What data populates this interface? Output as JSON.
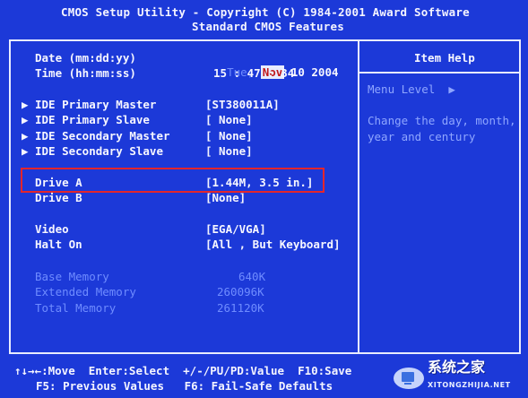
{
  "header": {
    "line1": "CMOS Setup Utility - Copyright (C) 1984-2001 Award Software",
    "line2": "Standard CMOS Features"
  },
  "settings": {
    "date_label": "Date (mm:dd:yy)",
    "date_day": "Tue,",
    "date_month": "Nov",
    "date_rest": "10 2004",
    "time_label": "Time (hh:mm:ss)",
    "time_value": "15 : 47 : 34",
    "ide_items": [
      {
        "label": "IDE Primary Master",
        "value": "[ST380011A]"
      },
      {
        "label": "IDE Primary Slave",
        "value": "[ None]"
      },
      {
        "label": "IDE Secondary Master",
        "value": "[ None]"
      },
      {
        "label": "IDE Secondary Slave",
        "value": "[ None]"
      }
    ],
    "drive_a_label": "Drive A",
    "drive_a_value": "[1.44M, 3.5 in.]",
    "drive_b_label": "Drive B",
    "drive_b_value": "[None]",
    "video_label": "Video",
    "video_value": "[EGA/VGA]",
    "halt_label": "Halt On",
    "halt_value": "[All , But Keyboard]",
    "memory": [
      {
        "label": "Base Memory",
        "value": "640K"
      },
      {
        "label": "Extended Memory",
        "value": "260096K"
      },
      {
        "label": "Total Memory",
        "value": "261120K"
      }
    ]
  },
  "help": {
    "title": "Item Help",
    "menu_level": "Menu Level",
    "text_line1": "Change the day, month,",
    "text_line2": "year and century"
  },
  "footer": {
    "line1": "↑↓→←:Move  Enter:Select  +/-/PU/PD:Value  F10:Save",
    "line2": "F5: Previous Values   F6: Fail-Safe Defaults"
  },
  "watermark": {
    "cn": "系统之家",
    "url": "XITONGZHIJIA.NET"
  },
  "colors": {
    "background": "#1c39d8",
    "highlight_box": "#e3262c",
    "dim_text": "#6f8cff"
  }
}
